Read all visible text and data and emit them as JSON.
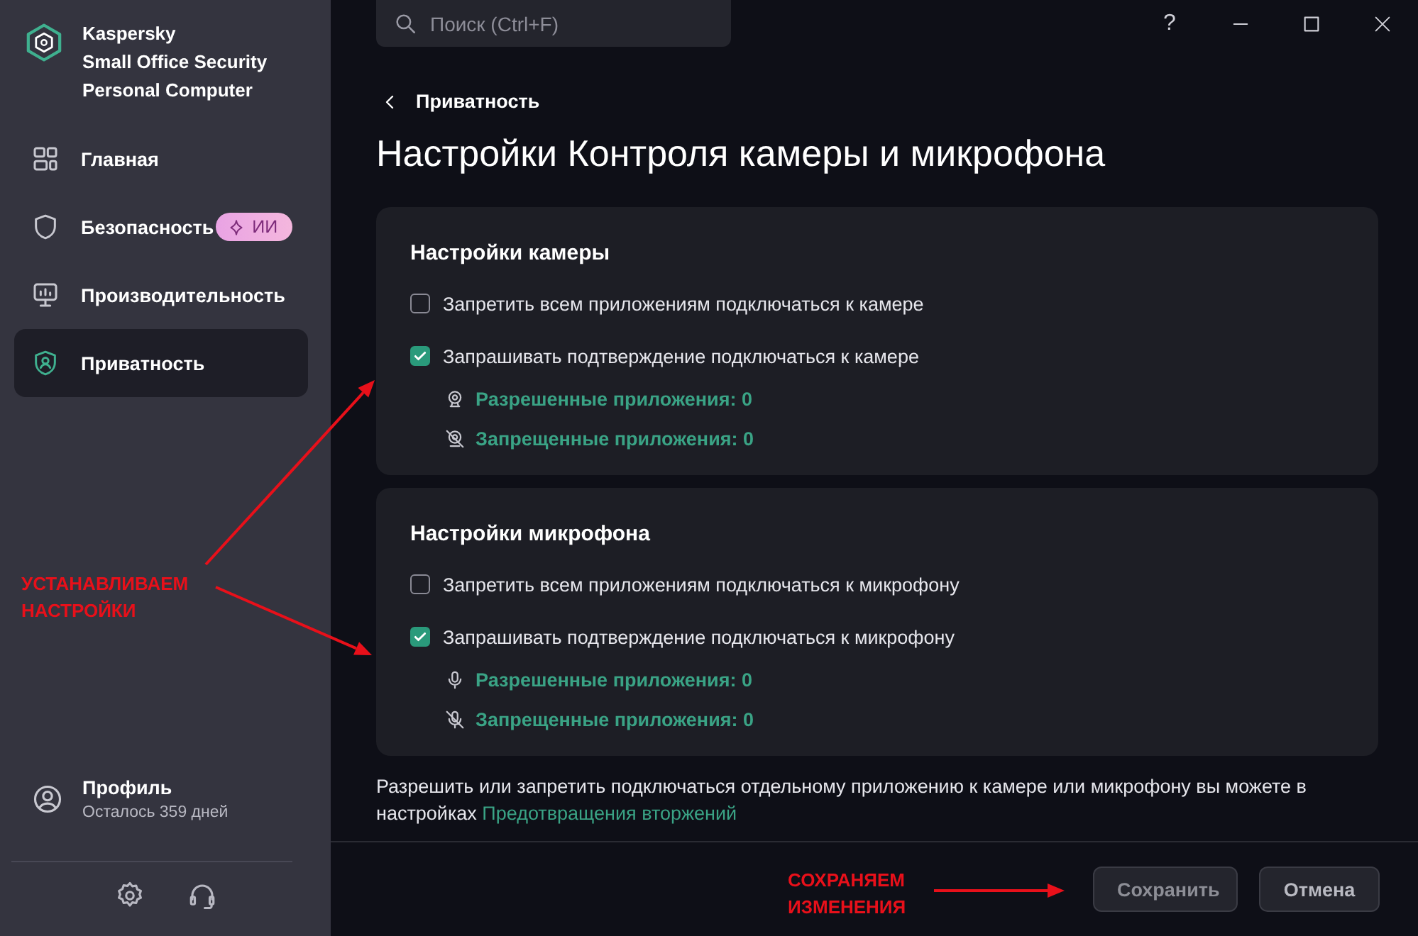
{
  "app": {
    "name_lines": [
      "Kaspersky",
      "Small Office Security",
      "Personal Computer"
    ]
  },
  "sidebar": {
    "items": [
      {
        "kind": "home",
        "label": "Главная",
        "selected": false
      },
      {
        "kind": "security",
        "label": "Безопасность",
        "selected": false,
        "badge": "ИИ"
      },
      {
        "kind": "performance",
        "label": "Производительность",
        "selected": false
      },
      {
        "kind": "privacy",
        "label": "Приватность",
        "selected": true
      }
    ],
    "profile": {
      "title": "Профиль",
      "subtitle": "Осталось 359 дней"
    }
  },
  "search": {
    "placeholder": "Поиск (Ctrl+F)"
  },
  "help": "?",
  "breadcrumb": "Приватность",
  "title": "Настройки Контроля камеры и микрофона",
  "sections": [
    {
      "kind": "camera",
      "title": "Настройки камеры",
      "options": [
        {
          "label": "Запретить всем приложениям подключаться к камере",
          "checked": false
        },
        {
          "label": "Запрашивать подтверждение подключаться к камере",
          "checked": true
        }
      ],
      "links": [
        {
          "kind": "allowed",
          "label": "Разрешенные приложения: 0"
        },
        {
          "kind": "blocked",
          "label": "Запрещенные приложения: 0"
        }
      ]
    },
    {
      "kind": "microphone",
      "title": "Настройки микрофона",
      "options": [
        {
          "label": "Запретить всем приложениям подключаться к микрофону",
          "checked": false
        },
        {
          "label": "Запрашивать подтверждение подключаться к микрофону",
          "checked": true
        }
      ],
      "links": [
        {
          "kind": "allowed",
          "label": "Разрешенные приложения: 0"
        },
        {
          "kind": "blocked",
          "label": "Запрещенные приложения: 0"
        }
      ]
    }
  ],
  "note": {
    "text": "Разрешить или запретить подключаться отдельному приложению к камере или микрофону вы можете в настройках",
    "link": "Предотвращения вторжений"
  },
  "buttons": [
    {
      "kind": "primary",
      "label": "Сохранить"
    },
    {
      "kind": "secondary",
      "label": "Отмена"
    }
  ],
  "annotations": [
    {
      "kind": "settings",
      "text": "УСТАНАВЛИВАЕМ НАСТРОЙКИ"
    },
    {
      "kind": "save",
      "text": "СОХРАНЯЕМ ИЗМЕНЕНИЯ"
    }
  ]
}
